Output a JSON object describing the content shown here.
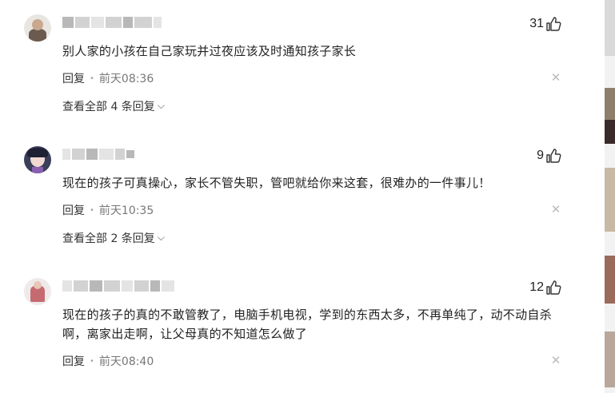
{
  "comments": [
    {
      "likes": "31",
      "text": "别人家的小孩在自己家玩并过夜应该及时通知孩子家长",
      "reply_label": "回复",
      "time": "前天08:36",
      "view_all": "查看全部 4 条回复"
    },
    {
      "likes": "9",
      "text": "现在的孩子可真操心，家长不管失职，管吧就给你来这套，很难办的一件事儿！",
      "reply_label": "回复",
      "time": "前天10:35",
      "view_all": "查看全部 2 条回复"
    },
    {
      "likes": "12",
      "text": "现在的孩子的真的不敢管教了，电脑手机电视，学到的东西太多，不再单纯了，动不动自杀啊，离家出走啊，让父母真的不知道怎么做了",
      "reply_label": "回复",
      "time": "前天08:40"
    }
  ],
  "icons": {
    "like": "thumbs-up-icon",
    "close": "close-icon",
    "expand": "chevron-down-icon"
  },
  "colors": {
    "text": "#222222",
    "meta": "#777777",
    "close": "#bbbbbb",
    "divider": "#e8e8e8"
  }
}
